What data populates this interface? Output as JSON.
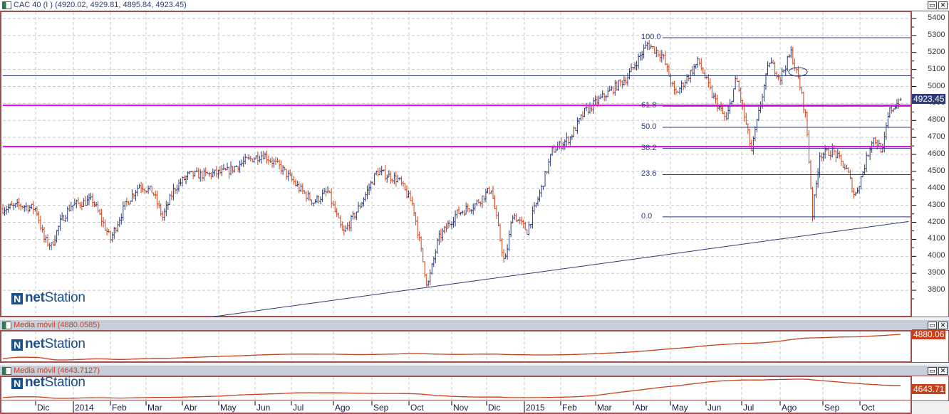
{
  "main": {
    "title": "CAC 40 (I ) (4920.02, 4929.81, 4895.84, 4923.45)",
    "last_price_tag": "4923.45",
    "y_ticks": [
      "5400",
      "5300",
      "5200",
      "5100",
      "5000",
      "4900",
      "4800",
      "4700",
      "4600",
      "4500",
      "4400",
      "4300",
      "4200",
      "4100",
      "4000",
      "3900",
      "3800"
    ],
    "fib_labels": [
      "100.0",
      "61.8",
      "50.0",
      "38.2",
      "23.6",
      "0.0"
    ],
    "logo": {
      "prefix": "net",
      "suffix": "Station"
    }
  },
  "panel1": {
    "title": "Media móvil (4880.0585)",
    "tag": "4880.06"
  },
  "panel2": {
    "title": "Media móvil (4643.7127)",
    "tag": "4643.71"
  },
  "window_buttons": {
    "maximize": "▭",
    "close": "✕"
  },
  "x_axis": {
    "months": [
      "Dic",
      "2014",
      "Feb",
      "Mar",
      "Abr",
      "May",
      "Jun",
      "Jul",
      "Ago",
      "Sep",
      "Oct",
      "Nov",
      "Dic",
      "2015",
      "Feb",
      "Mar",
      "Abr",
      "May",
      "Jun",
      "Jul",
      "Ago",
      "Sep",
      "Oct"
    ]
  },
  "colors": {
    "up": "#2b3a7a",
    "down": "#d0441c",
    "support": "#ff00ff",
    "ma": "#c8401a",
    "navy": "#2b3a7a"
  },
  "chart_data": {
    "type": "ohlc",
    "instrument": "CAC 40",
    "last": {
      "open": 4920.02,
      "high": 4929.81,
      "low": 4895.84,
      "close": 4923.45
    },
    "ylim": [
      3650,
      5450
    ],
    "weekly_keypoints": [
      [
        0,
        4280
      ],
      [
        2,
        4300
      ],
      [
        3.7,
        4280
      ],
      [
        4.6,
        4100
      ],
      [
        5.4,
        4060
      ],
      [
        6.4,
        4200
      ],
      [
        7.6,
        4300
      ],
      [
        10,
        4330
      ],
      [
        12,
        4100
      ],
      [
        13.6,
        4300
      ],
      [
        15.2,
        4420
      ],
      [
        16.7,
        4380
      ],
      [
        17.8,
        4230
      ],
      [
        19.1,
        4400
      ],
      [
        20.7,
        4480
      ],
      [
        22.7,
        4480
      ],
      [
        25,
        4500
      ],
      [
        27,
        4560
      ],
      [
        29,
        4600
      ],
      [
        31,
        4520
      ],
      [
        33,
        4400
      ],
      [
        34.6,
        4320
      ],
      [
        36.2,
        4380
      ],
      [
        37.9,
        4130
      ],
      [
        39.8,
        4300
      ],
      [
        41.7,
        4500
      ],
      [
        44.1,
        4450
      ],
      [
        45.7,
        4300
      ],
      [
        47.3,
        3820
      ],
      [
        48.5,
        4100
      ],
      [
        50.5,
        4250
      ],
      [
        52.5,
        4300
      ],
      [
        54.4,
        4400
      ],
      [
        55.9,
        3950
      ],
      [
        56.8,
        4250
      ],
      [
        58.4,
        4150
      ],
      [
        60,
        4400
      ],
      [
        61.2,
        4620
      ],
      [
        63.2,
        4700
      ],
      [
        64.8,
        4850
      ],
      [
        67.1,
        4950
      ],
      [
        69.5,
        5050
      ],
      [
        71.8,
        5250
      ],
      [
        73.5,
        5180
      ],
      [
        74.9,
        4950
      ],
      [
        77.5,
        5150
      ],
      [
        79,
        4950
      ],
      [
        80.6,
        4800
      ],
      [
        81.7,
        5050
      ],
      [
        83.4,
        4620
      ],
      [
        84.6,
        4950
      ],
      [
        85.4,
        5150
      ],
      [
        86.6,
        5050
      ],
      [
        87.8,
        5200
      ],
      [
        88.8,
        5000
      ],
      [
        89.5,
        4800
      ],
      [
        90.2,
        4250
      ],
      [
        91,
        4600
      ],
      [
        92.5,
        4620
      ],
      [
        94.1,
        4500
      ],
      [
        94.9,
        4350
      ],
      [
        95.7,
        4480
      ],
      [
        96.9,
        4700
      ],
      [
        98,
        4620
      ],
      [
        98.7,
        4850
      ],
      [
        100,
        4923.45
      ]
    ],
    "horizontal_lines": [
      5063
    ],
    "support_lines": [
      4889,
      4646
    ],
    "fibonacci": {
      "high": 5287,
      "low": 4232,
      "levels": [
        100.0,
        61.8,
        50.0,
        38.2,
        23.6,
        0.0
      ]
    },
    "trendline": [
      [
        23.5,
        3645
      ],
      [
        100.9,
        4205
      ]
    ],
    "moving_averages": [
      {
        "name": "Media móvil",
        "last": 4880.0585
      },
      {
        "name": "Media móvil",
        "last": 4643.7127
      }
    ]
  }
}
